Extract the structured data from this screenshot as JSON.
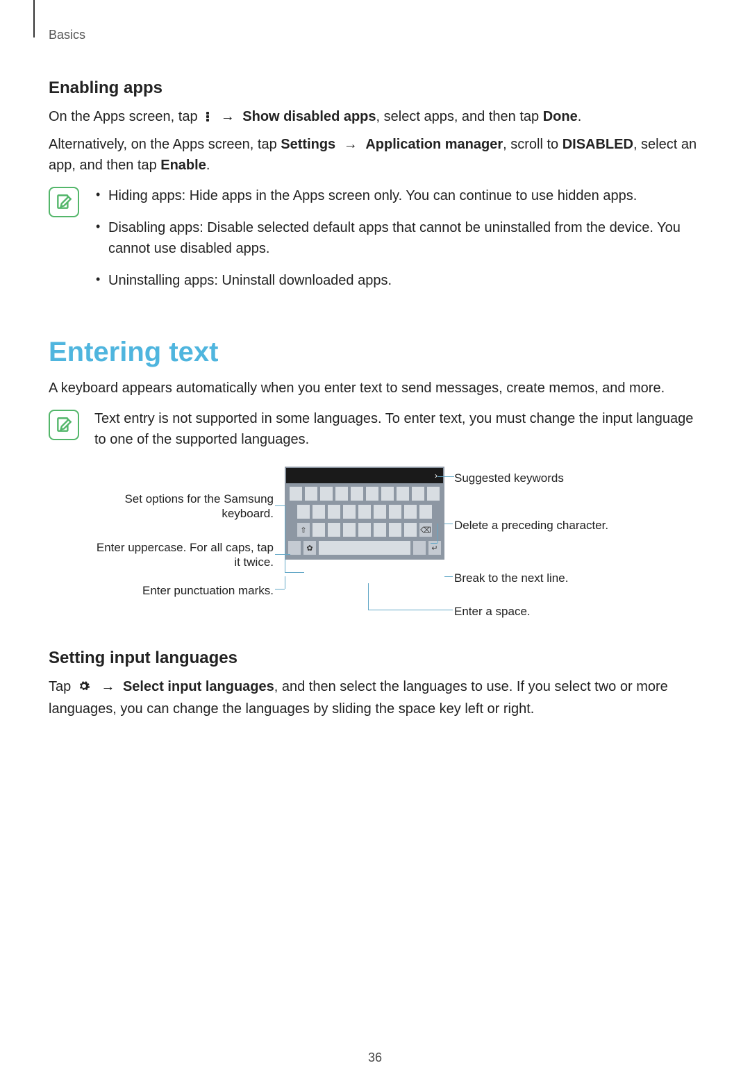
{
  "breadcrumb": "Basics",
  "enabling_heading": "Enabling apps",
  "para1_pre": "On the Apps screen, tap ",
  "para1_arrow": "→",
  "para1_show_disabled": "Show disabled apps",
  "para1_mid": ", select apps, and then tap ",
  "para1_done": "Done",
  "para1_end": ".",
  "para2_pre": "Alternatively, on the Apps screen, tap ",
  "para2_settings": "Settings",
  "para2_arrow": "→",
  "para2_appmgr": "Application manager",
  "para2_mid": ", scroll to ",
  "para2_disabled": "DISABLED",
  "para2_mid2": ", select an app, and then tap ",
  "para2_enable": "Enable",
  "para2_end": ".",
  "note1_items": [
    "Hiding apps: Hide apps in the Apps screen only. You can continue to use hidden apps.",
    "Disabling apps: Disable selected default apps that cannot be uninstalled from the device. You cannot use disabled apps.",
    "Uninstalling apps: Uninstall downloaded apps."
  ],
  "entering_heading": "Entering text",
  "entering_para": "A keyboard appears automatically when you enter text to send messages, create memos, and more.",
  "note2_text": "Text entry is not supported in some languages. To enter text, you must change the input language to one of the supported languages.",
  "callouts": {
    "suggested": "Suggested keywords",
    "set_options": "Set options for the Samsung keyboard.",
    "delete": "Delete a preceding character.",
    "uppercase": "Enter uppercase. For all caps, tap it twice.",
    "break_line": "Break to the next line.",
    "punctuation": "Enter punctuation marks.",
    "space": "Enter a space."
  },
  "setting_lang_heading": "Setting input languages",
  "setting_lang_pre": "Tap ",
  "setting_lang_arrow": "→",
  "setting_lang_select": "Select input languages",
  "setting_lang_rest": ", and then select the languages to use. If you select two or more languages, you can change the languages by sliding the space key left or right.",
  "page_number": "36"
}
